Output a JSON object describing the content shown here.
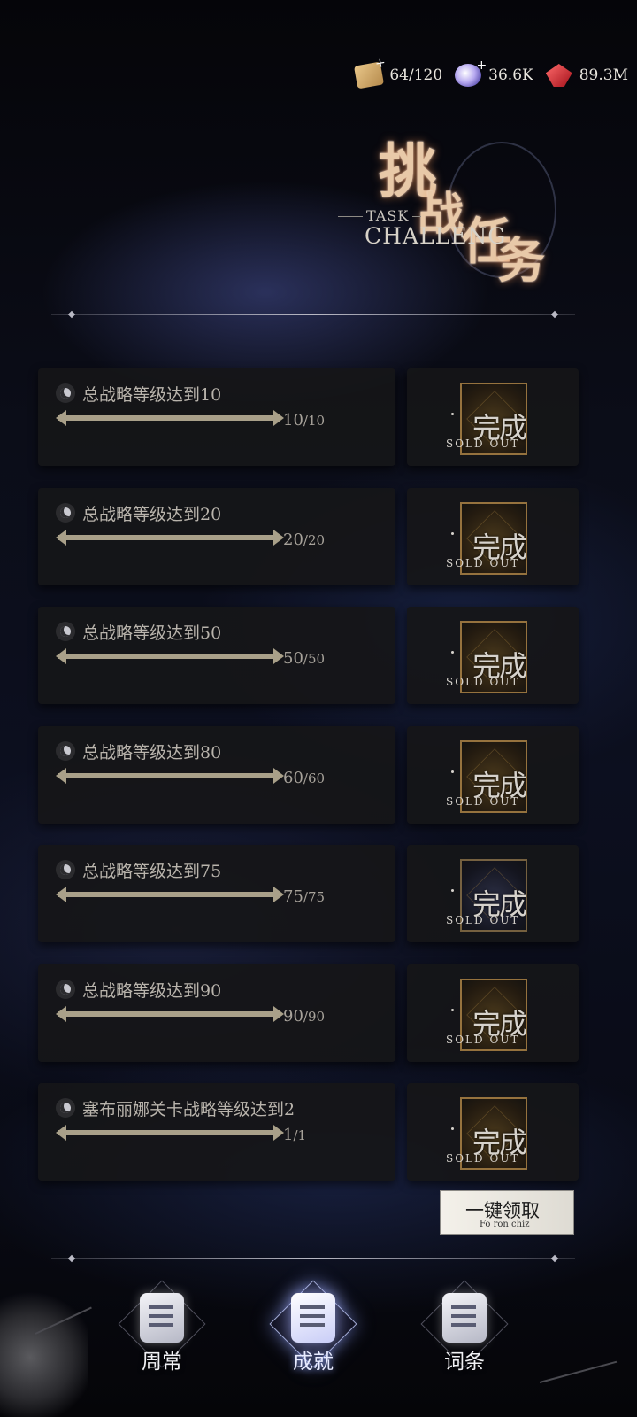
{
  "resources": [
    {
      "icon": "scroll-ticket-icon",
      "value": "64/120"
    },
    {
      "icon": "crystal-icon",
      "value": "36.6K"
    },
    {
      "icon": "ruby-icon",
      "value": "89.3M"
    }
  ],
  "header": {
    "title_cn": [
      "挑",
      "战",
      "任",
      "务"
    ],
    "title_en_small": "TASK",
    "title_en_large": "CHALLENG"
  },
  "tasks": [
    {
      "label": "总战略等级达到10",
      "progress": "10",
      "total": "/10",
      "fraction": 1.0,
      "stamp": "完成",
      "stamp_sub": "SOLD OUT"
    },
    {
      "label": "总战略等级达到20",
      "progress": "20",
      "total": "/20",
      "fraction": 1.0,
      "stamp": "完成",
      "stamp_sub": "SOLD OUT"
    },
    {
      "label": "总战略等级达到50",
      "progress": "50",
      "total": "/50",
      "fraction": 1.0,
      "stamp": "完成",
      "stamp_sub": "SOLD OUT"
    },
    {
      "label": "总战略等级达到80",
      "progress": "60",
      "total": "/60",
      "fraction": 1.0,
      "stamp": "完成",
      "stamp_sub": "SOLD OUT"
    },
    {
      "label": "总战略等级达到75",
      "progress": "75",
      "total": "/75",
      "fraction": 1.0,
      "stamp": "完成",
      "stamp_sub": "SOLD OUT"
    },
    {
      "label": "总战略等级达到90",
      "progress": "90",
      "total": "/90",
      "fraction": 1.0,
      "stamp": "完成",
      "stamp_sub": "SOLD OUT"
    },
    {
      "label": "塞布丽娜关卡战略等级达到2",
      "progress": "1",
      "total": "/1",
      "fraction": 1.0,
      "stamp": "完成",
      "stamp_sub": "SOLD OUT"
    }
  ],
  "claim_all": {
    "label": "一键领取",
    "sub": "Fo ron chiz"
  },
  "nav": [
    {
      "label": "周常",
      "active": false
    },
    {
      "label": "成就",
      "active": true
    },
    {
      "label": "词条",
      "active": false
    }
  ]
}
